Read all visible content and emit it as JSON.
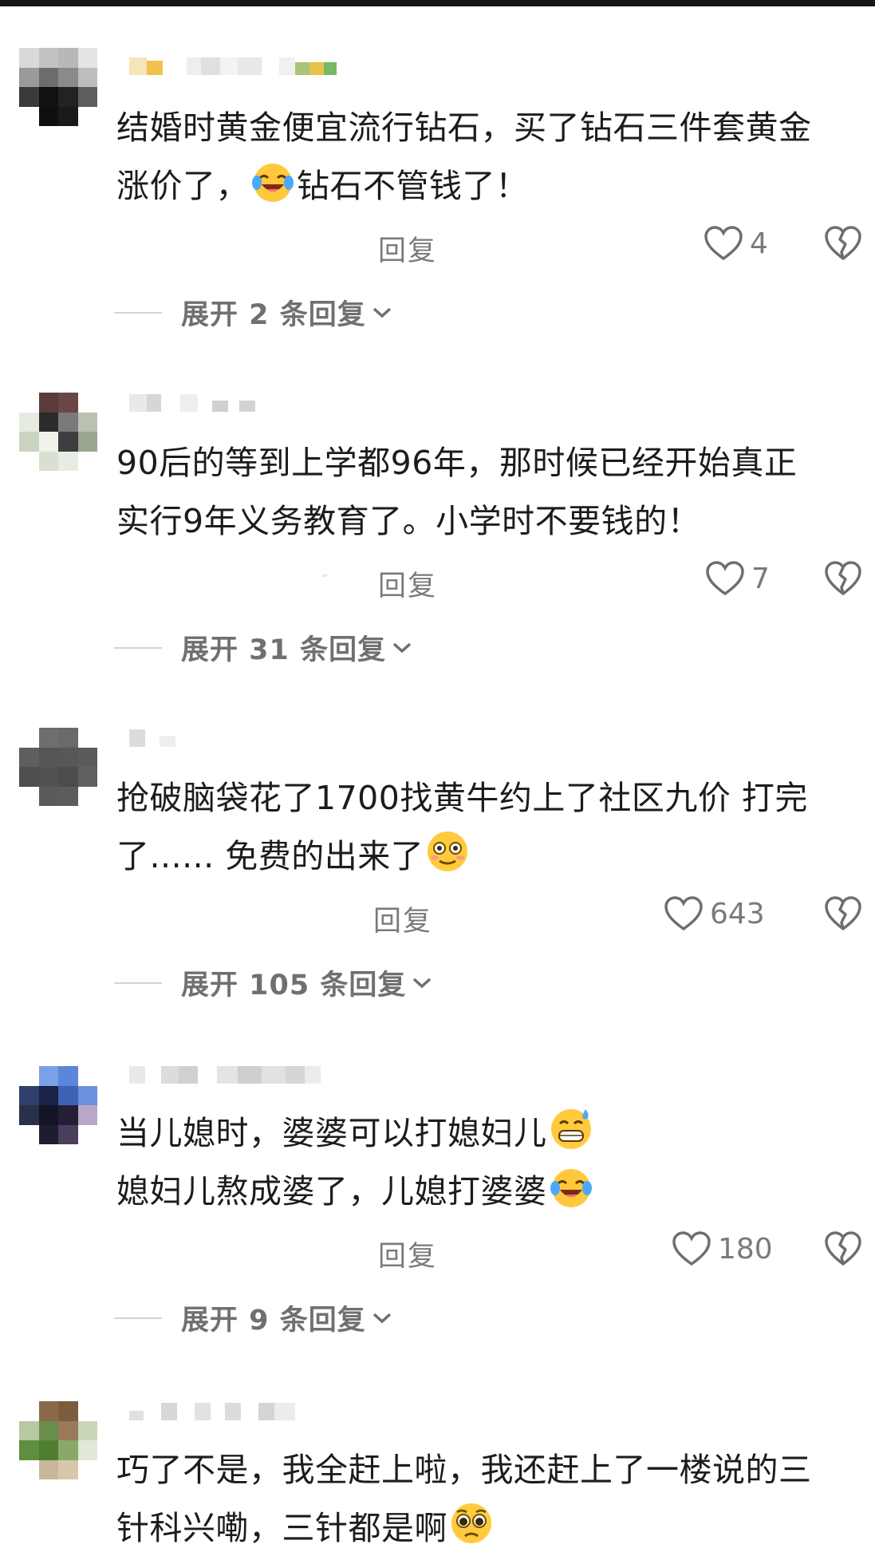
{
  "screen": {
    "title": ""
  },
  "colors": {
    "text": "#1c1c1c",
    "meta": "#7a7a7a",
    "expand": "#707070"
  },
  "comments": [
    {
      "lines": [
        "结婚时黄金便宜流行钻石，买了钻石三件套黄金",
        "涨价了，{emoji}钻石不管钱了！"
      ],
      "emoji": "laughing-crying-emoji",
      "reply_label": "回复",
      "likes": "4",
      "expand_label": "展开 2 条回复"
    },
    {
      "lines": [
        "90后的等到上学都96年，那时候已经开始真正",
        "实行9年义务教育了。小学时不要钱的！"
      ],
      "reply_label": "回复",
      "likes": "7",
      "expand_label": "展开 31 条回复"
    },
    {
      "lines": [
        "抢破脑袋花了1700找黄牛约上了社区九价  打完",
        "了...... 免费的出来了{emoji}"
      ],
      "emoji": "flushed-emoji",
      "reply_label": "回复",
      "likes": "643",
      "expand_label": "展开 105 条回复"
    },
    {
      "lines": [
        "当儿媳时，婆婆可以打媳妇儿{emoji}",
        "媳妇儿熬成婆了，儿媳打婆婆{emoji}"
      ],
      "emoji": "grin-sweat-emoji",
      "emoji2": "laughing-crying-emoji",
      "reply_label": "回复",
      "likes": "180",
      "expand_label": "展开 9 条回复"
    },
    {
      "lines": [
        "巧了不是，我全赶上啦，我还赶上了一楼说的三",
        "针科兴嘞，三针都是啊{emoji}"
      ],
      "emoji": "pleading-emoji"
    }
  ]
}
